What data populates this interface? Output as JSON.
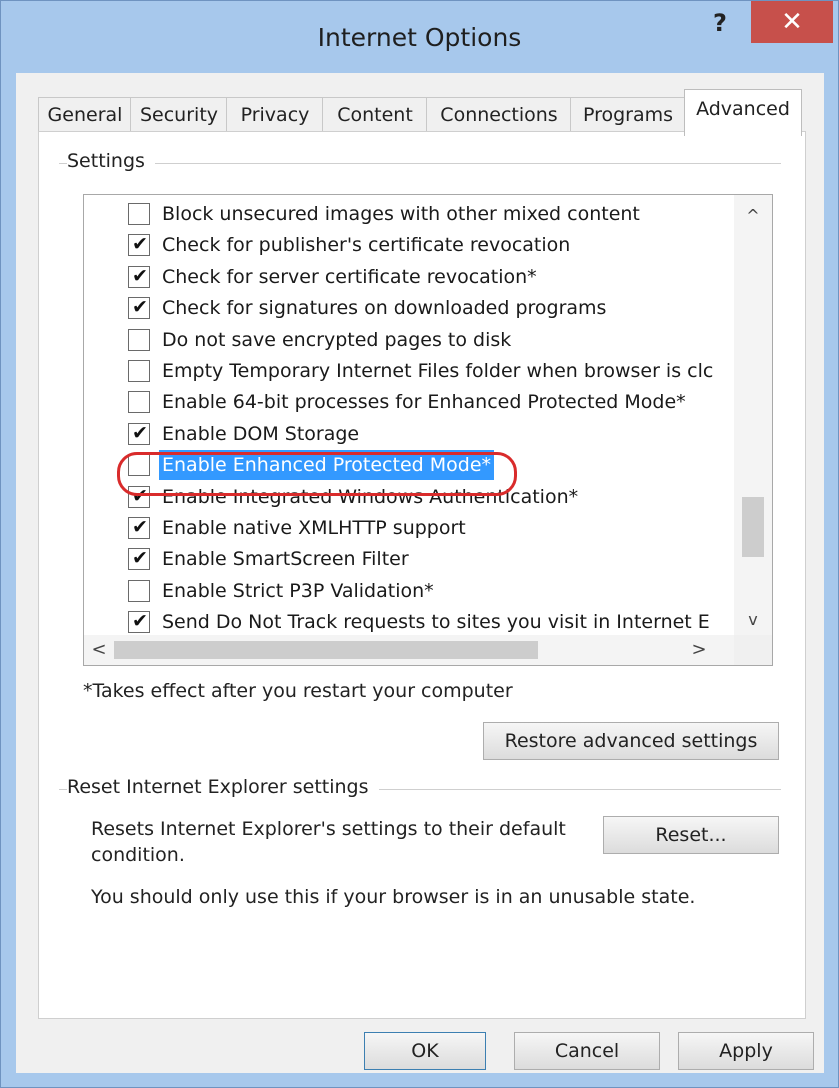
{
  "window": {
    "title": "Internet Options",
    "help_label": "?",
    "close_label": "✕"
  },
  "tabs": [
    "General",
    "Security",
    "Privacy",
    "Content",
    "Connections",
    "Programs",
    "Advanced"
  ],
  "settings": {
    "group_label": "Settings",
    "items": [
      {
        "label": "Block unsecured images with other mixed content",
        "checked": false
      },
      {
        "label": "Check for publisher's certificate revocation",
        "checked": true
      },
      {
        "label": "Check for server certificate revocation*",
        "checked": true
      },
      {
        "label": "Check for signatures on downloaded programs",
        "checked": true
      },
      {
        "label": "Do not save encrypted pages to disk",
        "checked": false
      },
      {
        "label": "Empty Temporary Internet Files folder when browser is clc",
        "checked": false
      },
      {
        "label": "Enable 64-bit processes for Enhanced Protected Mode*",
        "checked": false
      },
      {
        "label": "Enable DOM Storage",
        "checked": true
      },
      {
        "label": "Enable Enhanced Protected Mode*",
        "checked": false,
        "selected": true
      },
      {
        "label": "Enable Integrated Windows Authentication*",
        "checked": true
      },
      {
        "label": "Enable native XMLHTTP support",
        "checked": true
      },
      {
        "label": "Enable SmartScreen Filter",
        "checked": true
      },
      {
        "label": "Enable Strict P3P Validation*",
        "checked": false
      },
      {
        "label": "Send Do Not Track requests to sites you visit in Internet E",
        "checked": true
      }
    ],
    "check_glyph": "✔",
    "scroll": {
      "up": "^",
      "down": "v",
      "left": "<",
      "right": ">"
    },
    "note": "*Takes effect after you restart your computer",
    "restore_label": "Restore advanced settings"
  },
  "reset": {
    "group_label": "Reset Internet Explorer settings",
    "description_line1": "Resets Internet Explorer's settings to their default",
    "description_line2": "condition.",
    "reset_label": "Reset...",
    "warning": "You should only use this if your browser is in an unusable state."
  },
  "footer": {
    "ok_label": "OK",
    "cancel_label": "Cancel",
    "apply_label": "Apply"
  },
  "colors": {
    "selection": "#3399ff",
    "highlight_ring": "#d92b2b",
    "close_button": "#c7504b",
    "title_bar": "#a7c8ec"
  }
}
